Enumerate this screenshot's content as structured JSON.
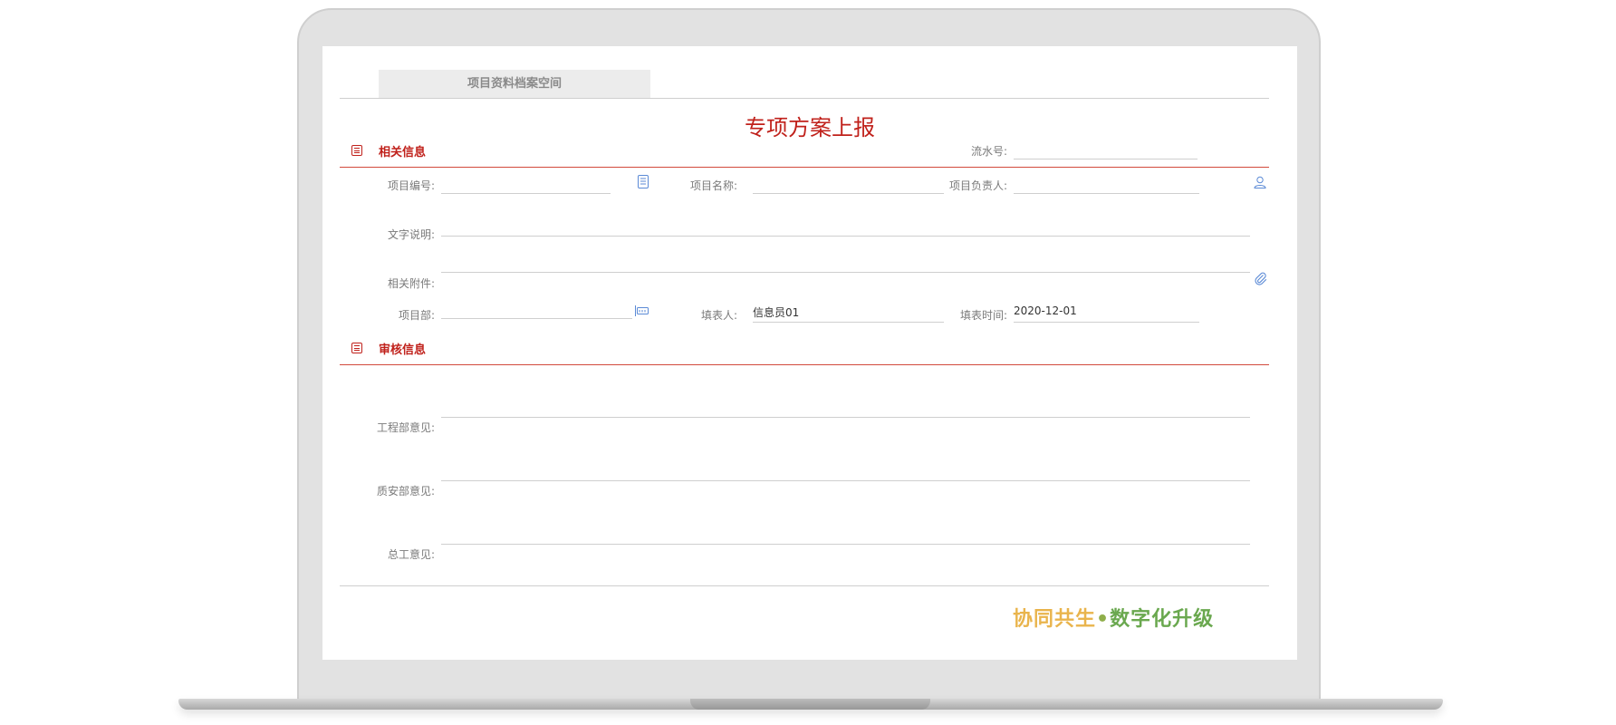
{
  "tab": {
    "label": "项目资料档案空间"
  },
  "form": {
    "title": "专项方案上报"
  },
  "sections": {
    "related": {
      "title": "相关信息"
    },
    "review": {
      "title": "审核信息"
    }
  },
  "fields": {
    "serial_no": {
      "label": "流水号:",
      "value": ""
    },
    "project_code": {
      "label": "项目编号:",
      "value": ""
    },
    "project_name": {
      "label": "项目名称:",
      "value": ""
    },
    "project_manager": {
      "label": "项目负责人:",
      "value": ""
    },
    "description": {
      "label": "文字说明:",
      "value": ""
    },
    "attachment": {
      "label": "相关附件:",
      "value": ""
    },
    "project_dept": {
      "label": "项目部:",
      "value": ""
    },
    "filler": {
      "label": "填表人:",
      "value": "信息员01"
    },
    "fill_date": {
      "label": "填表时间:",
      "value": "2020-12-01"
    },
    "eng_opinion": {
      "label": "工程部意见:",
      "value": ""
    },
    "qs_opinion": {
      "label": "质安部意见:",
      "value": ""
    },
    "chief_opinion": {
      "label": "总工意见:",
      "value": ""
    }
  },
  "footer": {
    "slogan_part1": "协同共生",
    "slogan_dot": "•",
    "slogan_part2": "数字化升级"
  },
  "colors": {
    "accent": "#c0211b",
    "icon": "#5b8ad6",
    "slogan_gradient_start": "#e9b44c",
    "slogan_gradient_end": "#6aa84f"
  },
  "icons": {
    "section": "list-icon",
    "project_code": "document-picker-icon",
    "project_manager": "user-icon",
    "attachment": "paperclip-icon",
    "project_dept": "org-picker-icon"
  }
}
